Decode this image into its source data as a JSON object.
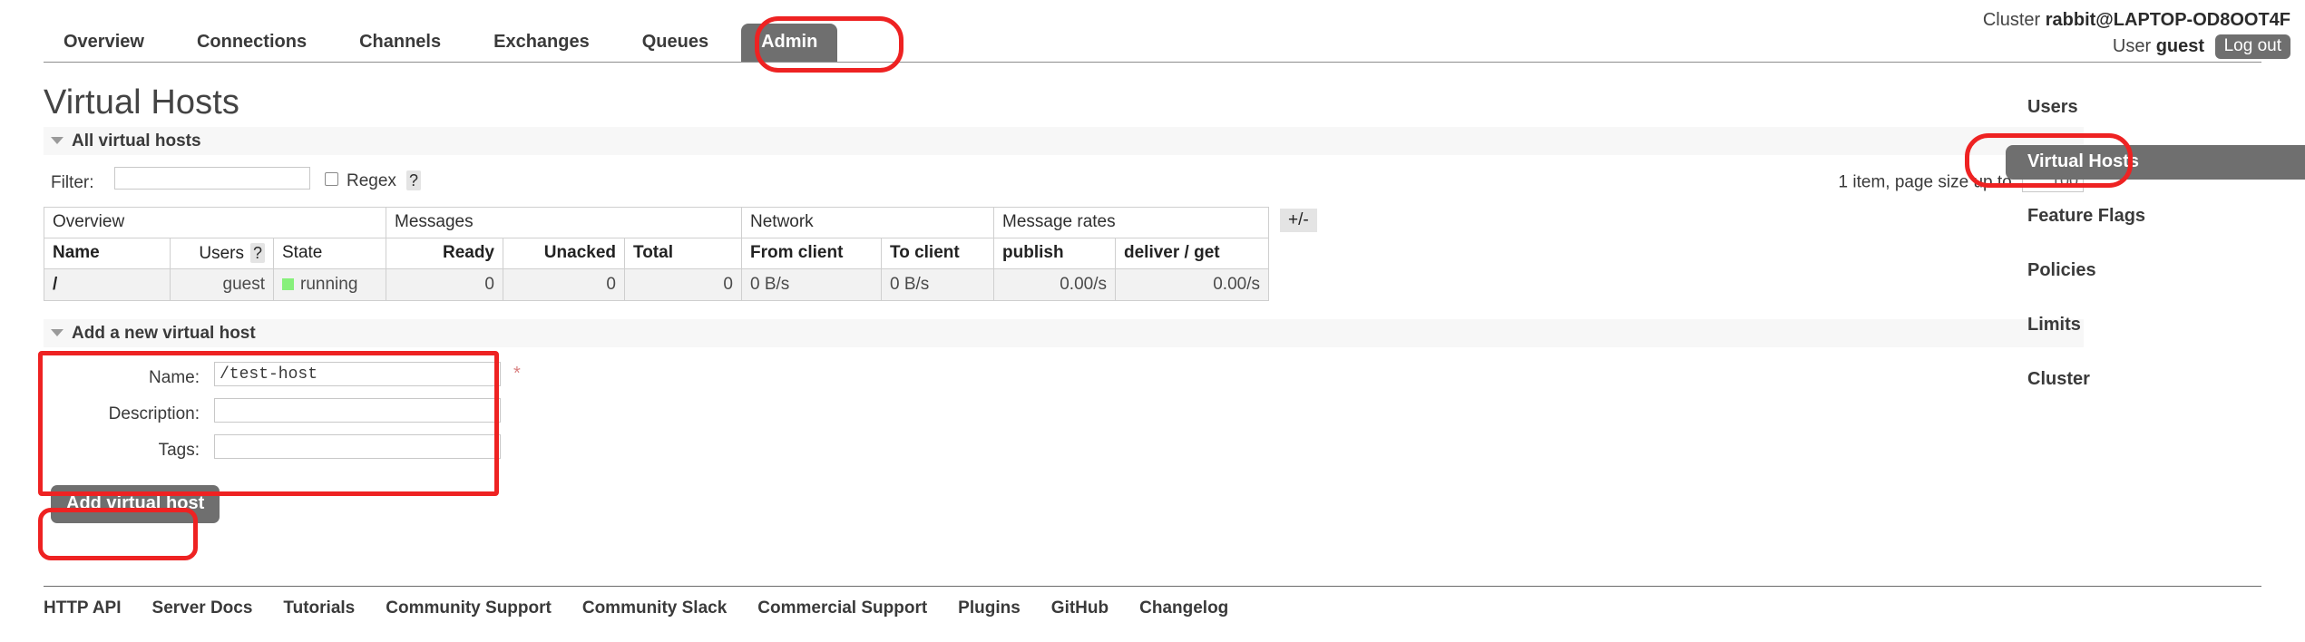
{
  "header": {
    "cluster_prefix": "Cluster",
    "cluster_name": "rabbit@LAPTOP-OD8OOT4F",
    "user_prefix": "User",
    "user_name": "guest",
    "logout_label": "Log out"
  },
  "nav": {
    "items": [
      {
        "label": "Overview",
        "selected": false
      },
      {
        "label": "Connections",
        "selected": false
      },
      {
        "label": "Channels",
        "selected": false
      },
      {
        "label": "Exchanges",
        "selected": false
      },
      {
        "label": "Queues",
        "selected": false
      },
      {
        "label": "Admin",
        "selected": true
      }
    ]
  },
  "page": {
    "title": "Virtual Hosts"
  },
  "all_virtual_hosts": {
    "section_title": "All virtual hosts",
    "filter_label": "Filter:",
    "filter_value": "",
    "filter_placeholder": "",
    "regex_label": "Regex",
    "regex_checked": false,
    "regex_help": "?",
    "paging_text": "1 item, page size up to",
    "page_size": "100",
    "plus_minus_label": "+/-",
    "group_headers": [
      "Overview",
      "Messages",
      "Network",
      "Message rates"
    ],
    "columns": [
      {
        "label": "Name",
        "bold": true,
        "align": "l"
      },
      {
        "label": "Users",
        "bold": false,
        "align": "r",
        "help": "?"
      },
      {
        "label": "State",
        "bold": false,
        "align": "l"
      },
      {
        "label": "Ready",
        "bold": true,
        "align": "r"
      },
      {
        "label": "Unacked",
        "bold": true,
        "align": "r"
      },
      {
        "label": "Total",
        "bold": true,
        "align": "l"
      },
      {
        "label": "From client",
        "bold": true,
        "align": "l"
      },
      {
        "label": "To client",
        "bold": true,
        "align": "l"
      },
      {
        "label": "publish",
        "bold": true,
        "align": "l"
      },
      {
        "label": "deliver / get",
        "bold": true,
        "align": "l"
      }
    ],
    "rows": [
      {
        "name": "/",
        "users": "guest",
        "state": "running",
        "state_color": "#87f07b",
        "ready": "0",
        "unacked": "0",
        "total": "0",
        "from_client": "0 B/s",
        "to_client": "0 B/s",
        "publish": "0.00/s",
        "deliver_get": "0.00/s"
      }
    ]
  },
  "add_form": {
    "section_title": "Add a new virtual host",
    "name_label": "Name:",
    "name_value": "/test-host",
    "required_marker": "*",
    "description_label": "Description:",
    "description_value": "",
    "tags_label": "Tags:",
    "tags_value": "",
    "submit_label": "Add virtual host"
  },
  "sidebar": {
    "items": [
      {
        "label": "Users",
        "selected": false
      },
      {
        "label": "Virtual Hosts",
        "selected": true
      },
      {
        "label": "Feature Flags",
        "selected": false
      },
      {
        "label": "Policies",
        "selected": false
      },
      {
        "label": "Limits",
        "selected": false
      },
      {
        "label": "Cluster",
        "selected": false
      }
    ]
  },
  "footer": {
    "links": [
      "HTTP API",
      "Server Docs",
      "Tutorials",
      "Community Support",
      "Community Slack",
      "Commercial Support",
      "Plugins",
      "GitHub",
      "Changelog"
    ]
  },
  "annotations": {
    "color": "#ee2222",
    "targets": [
      "admin-tab",
      "sidebar-virtual-hosts",
      "add-virtual-host-form",
      "add-virtual-host-button"
    ]
  }
}
